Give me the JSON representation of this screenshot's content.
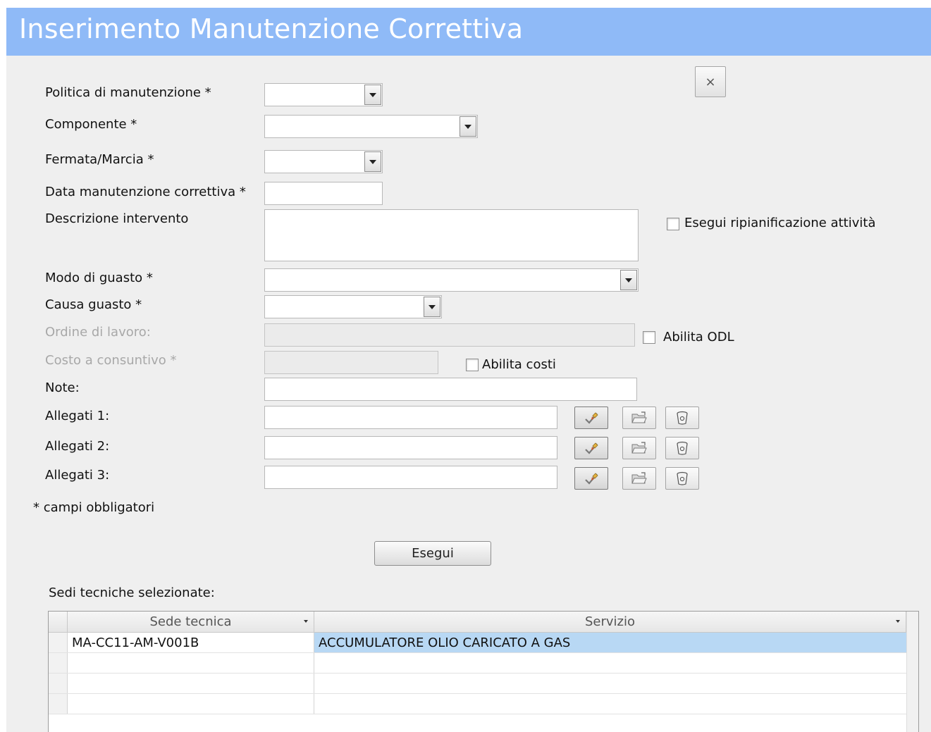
{
  "window": {
    "title": "Inserimento Manutenzione Correttiva"
  },
  "form": {
    "politica_label": "Politica di manutenzione *",
    "componente_label": "Componente *",
    "fermata_label": "Fermata/Marcia *",
    "data_label": "Data manutenzione correttiva *",
    "descrizione_label": "Descrizione intervento",
    "modo_label": "Modo di guasto *",
    "causa_label": "Causa guasto *",
    "ordine_label": "Ordine di lavoro:",
    "costo_label": "Costo  a consuntivo *",
    "note_label": "Note:",
    "allegati1_label": "Allegati 1:",
    "allegati2_label": "Allegati 2:",
    "allegati3_label": "Allegati 3:",
    "ripianificazione_label": "Esegui ripianificazione attività",
    "abilita_odl_label": "Abilita ODL",
    "abilita_costi_label": "Abilita costi",
    "obbligatori_note": "* campi obbligatori",
    "esegui_label": "Esegui",
    "close_label": "×",
    "ripianificazione_checked": false,
    "abilita_odl_checked": false,
    "abilita_costi_checked": false
  },
  "grid": {
    "title": "Sedi tecniche selezionate:",
    "columns": [
      "Sede tecnica",
      "Servizio"
    ],
    "rows": [
      {
        "sede": "MA-CC11-AM-V001B",
        "servizio": "ACCUMULATORE OLIO CARICATO A GAS"
      },
      {
        "sede": "",
        "servizio": ""
      },
      {
        "sede": "",
        "servizio": ""
      },
      {
        "sede": "",
        "servizio": ""
      }
    ]
  },
  "icons": {
    "attach_select": "pencil-check-icon",
    "attach_open": "folder-open-icon",
    "attach_delete": "trash-can-icon",
    "dropdown": "chevron-down-icon"
  },
  "colors": {
    "header": "#8fbaf7",
    "row_highlight": "#b8d8f4",
    "disabled_text": "#a8a8a8"
  }
}
